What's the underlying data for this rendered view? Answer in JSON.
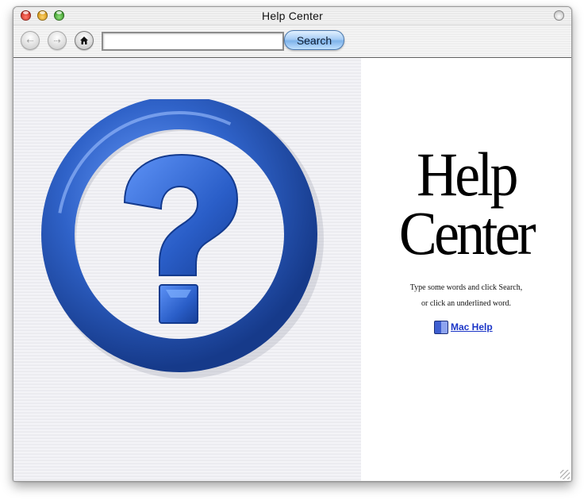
{
  "window": {
    "title": "Help Center"
  },
  "toolbar": {
    "back_icon": "back-arrow-icon",
    "forward_icon": "forward-arrow-icon",
    "home_icon": "home-icon",
    "search_value": "",
    "search_button_label": "Search"
  },
  "main": {
    "logo_icon": "question-mark-ring-icon",
    "hero_line1": "Help",
    "hero_line2": "Center",
    "instruction_line1": "Type some words and click Search,",
    "instruction_line2": "or click an underlined word.",
    "link_label": "Mac Help",
    "link_icon": "mac-help-book-icon"
  },
  "colors": {
    "accent_blue": "#2f62c8",
    "link_blue": "#1b35c7"
  }
}
